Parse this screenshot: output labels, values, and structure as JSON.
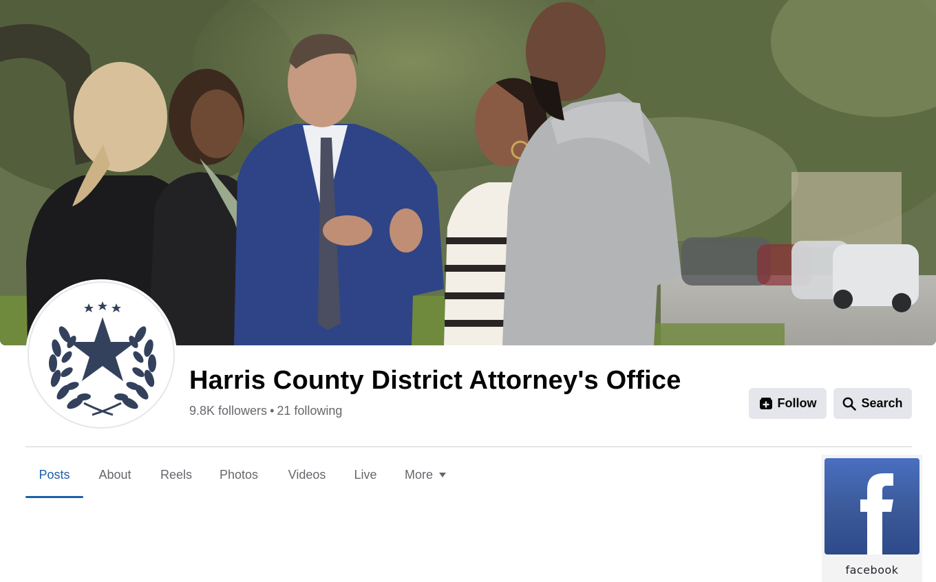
{
  "page": {
    "title": "Harris County District Attorney's Office",
    "followers": "9.8K followers",
    "separator": "•",
    "following": "21 following"
  },
  "actions": {
    "follow_label": "Follow",
    "search_label": "Search"
  },
  "tabs": [
    {
      "label": "Posts",
      "active": true
    },
    {
      "label": "About",
      "active": false
    },
    {
      "label": "Reels",
      "active": false
    },
    {
      "label": "Photos",
      "active": false
    },
    {
      "label": "Videos",
      "active": false
    },
    {
      "label": "Live",
      "active": false
    },
    {
      "label": "More",
      "active": false
    }
  ],
  "badge": {
    "label": "facebook"
  },
  "colors": {
    "active_tab": "#1b5fa8",
    "button_bg": "#e4e6eb",
    "muted_text": "#65676b",
    "seal": "#33415c",
    "facebook_blue": "#3b5998"
  },
  "icons": {
    "follow": "follow-icon",
    "search": "search-icon",
    "more": "caret-down-icon",
    "avatar": "star-laurel-seal-icon",
    "badge": "facebook-logo-icon"
  }
}
